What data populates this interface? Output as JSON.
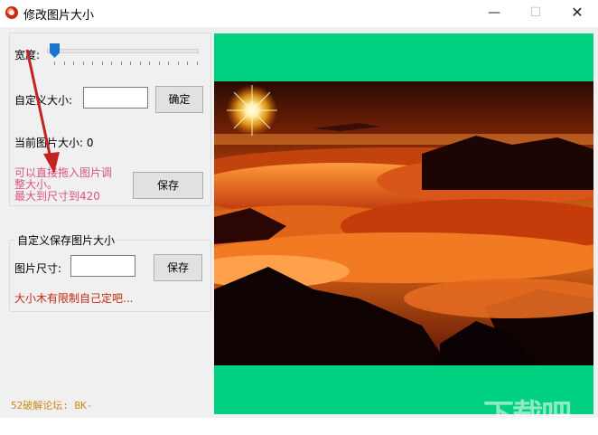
{
  "window": {
    "title": "修改图片大小",
    "min_glyph": "—",
    "max_glyph": "☐",
    "close_glyph": "✕"
  },
  "resize_group": {
    "width_label": "宽度:",
    "width_slider_value": 0,
    "custom_size_label": "自定义大小:",
    "custom_size_value": "",
    "confirm_button": "确定",
    "current_size_label": "当前图片大小: 0",
    "hint_line1": "可以直接拖入图片调",
    "hint_line2": "整大小。",
    "hint_line3": "最大到尺寸到420",
    "save_button": "保存"
  },
  "custom_save_group": {
    "title": "自定义保存图片大小",
    "size_label": "图片尺寸:",
    "size_value": "",
    "save_button": "保存",
    "warning": "大小木有限制自己定吧..."
  },
  "footer": {
    "credit": "52破解论坛:  BK-"
  },
  "preview": {
    "background_color": "#00d180"
  },
  "watermark": {
    "text": "下载吧"
  }
}
